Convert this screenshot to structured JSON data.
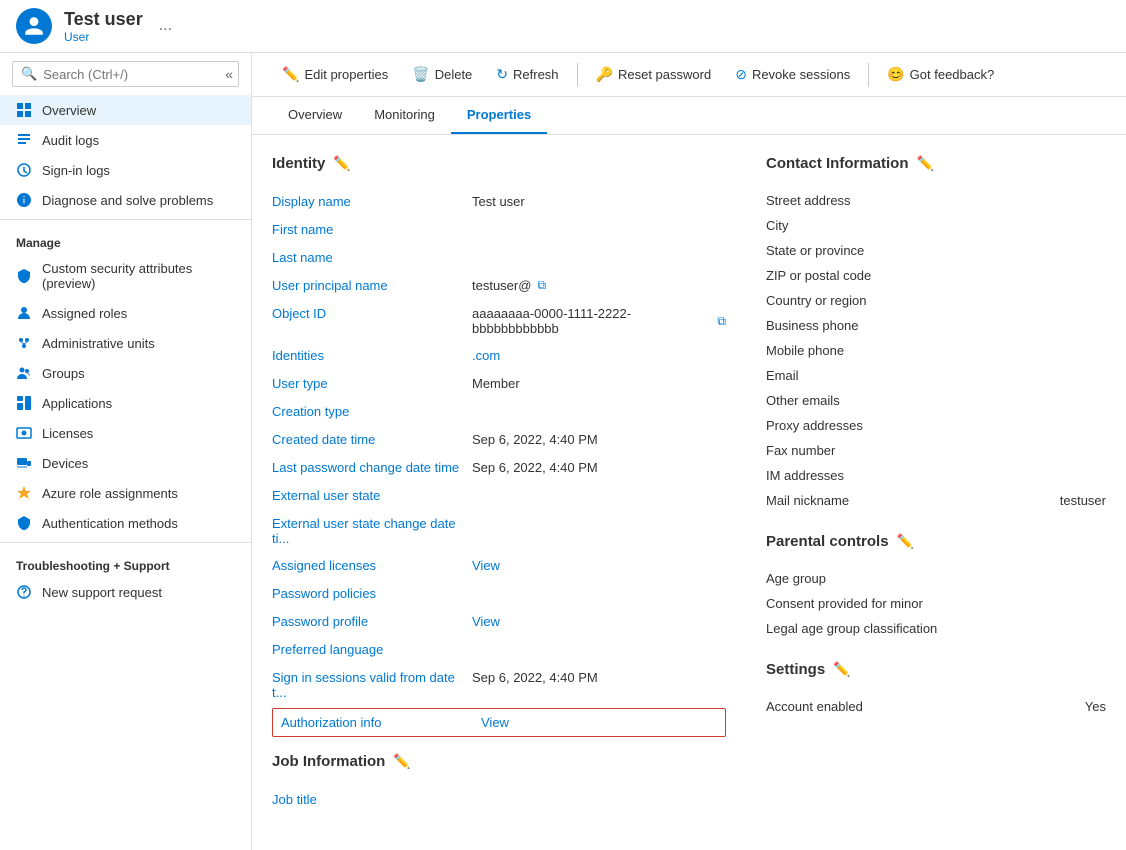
{
  "header": {
    "user_name": "Test user",
    "user_type": "User",
    "ellipsis": "..."
  },
  "search": {
    "placeholder": "Search (Ctrl+/)"
  },
  "sidebar": {
    "overview_label": "Overview",
    "audit_logs_label": "Audit logs",
    "sign_in_logs_label": "Sign-in logs",
    "diagnose_label": "Diagnose and solve problems",
    "manage_section": "Manage",
    "custom_security_label": "Custom security attributes (preview)",
    "assigned_roles_label": "Assigned roles",
    "admin_units_label": "Administrative units",
    "groups_label": "Groups",
    "applications_label": "Applications",
    "licenses_label": "Licenses",
    "devices_label": "Devices",
    "azure_roles_label": "Azure role assignments",
    "auth_methods_label": "Authentication methods",
    "troubleshooting_section": "Troubleshooting + Support",
    "new_support_label": "New support request"
  },
  "toolbar": {
    "edit_label": "Edit properties",
    "delete_label": "Delete",
    "refresh_label": "Refresh",
    "reset_password_label": "Reset password",
    "revoke_label": "Revoke sessions",
    "feedback_label": "Got feedback?"
  },
  "tabs": {
    "overview_label": "Overview",
    "monitoring_label": "Monitoring",
    "properties_label": "Properties"
  },
  "identity_section": {
    "title": "Identity",
    "fields": [
      {
        "label": "Display name",
        "value": "Test user",
        "type": "text"
      },
      {
        "label": "First name",
        "value": "",
        "type": "text"
      },
      {
        "label": "Last name",
        "value": "",
        "type": "text"
      },
      {
        "label": "User principal name",
        "value": "testuser@",
        "type": "copy"
      },
      {
        "label": "Object ID",
        "value": "aaaaaaaa-0000-1111-2222-bbbbbbbbbbbb",
        "type": "copy"
      },
      {
        "label": "Identities",
        "value": ".com",
        "type": "link"
      },
      {
        "label": "User type",
        "value": "Member",
        "type": "text"
      },
      {
        "label": "Creation type",
        "value": "",
        "type": "text"
      },
      {
        "label": "Created date time",
        "value": "Sep 6, 2022, 4:40 PM",
        "type": "text"
      },
      {
        "label": "Last password change date time",
        "value": "Sep 6, 2022, 4:40 PM",
        "type": "text"
      },
      {
        "label": "External user state",
        "value": "",
        "type": "text"
      },
      {
        "label": "External user state change date ti...",
        "value": "",
        "type": "text"
      },
      {
        "label": "Assigned licenses",
        "value": "View",
        "type": "view-link"
      },
      {
        "label": "Password policies",
        "value": "",
        "type": "text"
      },
      {
        "label": "Password profile",
        "value": "View",
        "type": "view-link"
      },
      {
        "label": "Preferred language",
        "value": "",
        "type": "text"
      },
      {
        "label": "Sign in sessions valid from date t...",
        "value": "Sep 6, 2022, 4:40 PM",
        "type": "text"
      }
    ],
    "auth_info": {
      "label": "Authorization info",
      "value": "View"
    },
    "job_section_title": "Job Information",
    "job_fields": [
      {
        "label": "Job title",
        "value": ""
      }
    ]
  },
  "contact_section": {
    "title": "Contact Information",
    "fields": [
      {
        "label": "Street address",
        "value": ""
      },
      {
        "label": "City",
        "value": ""
      },
      {
        "label": "State or province",
        "value": ""
      },
      {
        "label": "ZIP or postal code",
        "value": ""
      },
      {
        "label": "Country or region",
        "value": ""
      },
      {
        "label": "Business phone",
        "value": ""
      },
      {
        "label": "Mobile phone",
        "value": ""
      },
      {
        "label": "Email",
        "value": ""
      },
      {
        "label": "Other emails",
        "value": ""
      },
      {
        "label": "Proxy addresses",
        "value": ""
      },
      {
        "label": "Fax number",
        "value": ""
      },
      {
        "label": "IM addresses",
        "value": ""
      },
      {
        "label": "Mail nickname",
        "value": "testuser"
      }
    ]
  },
  "parental_section": {
    "title": "Parental controls",
    "fields": [
      {
        "label": "Age group",
        "value": ""
      },
      {
        "label": "Consent provided for minor",
        "value": ""
      },
      {
        "label": "Legal age group classification",
        "value": ""
      }
    ]
  },
  "settings_section": {
    "title": "Settings",
    "fields": [
      {
        "label": "Account enabled",
        "value": "Yes"
      }
    ]
  }
}
